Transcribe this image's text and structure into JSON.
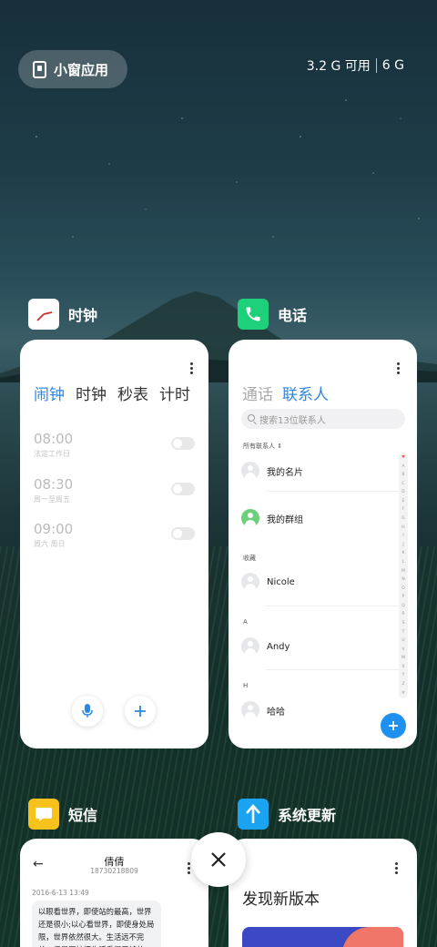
{
  "top": {
    "small_window_label": "小窗应用",
    "memory_available": "3.2 G 可用",
    "memory_total": "6 G"
  },
  "apps": {
    "clock": {
      "title": "时钟",
      "tabs": [
        "闹钟",
        "时钟",
        "秒表",
        "计时"
      ],
      "alarms": [
        {
          "time": "08:00",
          "repeat": "法定工作日"
        },
        {
          "time": "08:30",
          "repeat": "周一至周五"
        },
        {
          "time": "09:00",
          "repeat": "周六 周日"
        }
      ]
    },
    "phone": {
      "title": "电话",
      "tabs": [
        "通话",
        "联系人"
      ],
      "search_placeholder": "搜索13位联系人",
      "all_contacts_label": "所有联系人",
      "my_card": "我的名片",
      "my_group": "我的群组",
      "favorites_header": "收藏",
      "section_a": "A",
      "section_h": "H",
      "contacts": [
        "Nicole",
        "Andy",
        "哈哈"
      ],
      "index_letters": [
        "♥",
        "A",
        "B",
        "C",
        "D",
        "E",
        "F",
        "G",
        "H",
        "I",
        "J",
        "K",
        "L",
        "M",
        "N",
        "O",
        "P",
        "Q",
        "R",
        "S",
        "T",
        "U",
        "V",
        "W",
        "X",
        "Y",
        "Z",
        "#"
      ]
    },
    "sms": {
      "title": "短信",
      "contact_name": "倩倩",
      "contact_number": "18730218809",
      "timestamp": "2016-6-13 13:49",
      "message": "以眼看世界，即使站的最高，世界还是很小;以心看世界，即使身处局限，世界依然很大。生活远不完美，但是不妨把生活看得足够美好。"
    },
    "update": {
      "title": "系统更新",
      "headline": "发现新版本"
    }
  },
  "colors": {
    "accent": "#2d87e2",
    "clock_icon_bg": "#ffffff",
    "phone_icon_bg": "#1fd07a",
    "sms_icon_bg": "#f7c21c",
    "update_icon_bg": "#1aa3f0"
  },
  "icons": {
    "small_window": "phone-window-icon",
    "close": "close-icon"
  }
}
